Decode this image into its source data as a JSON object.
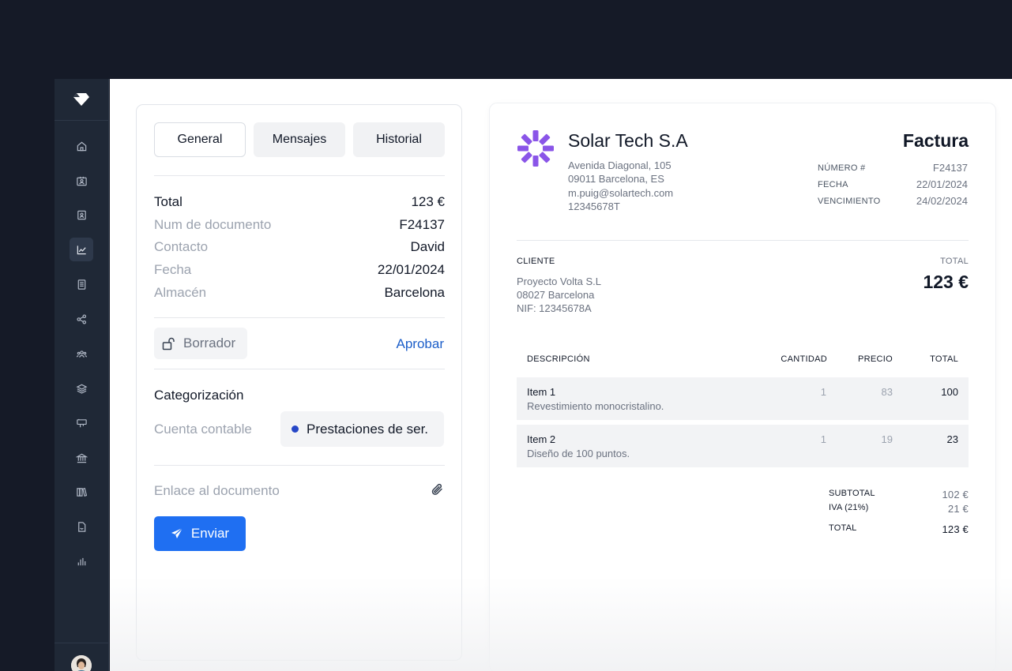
{
  "tabs": [
    {
      "label": "General"
    },
    {
      "label": "Mensajes"
    },
    {
      "label": "Historial"
    }
  ],
  "summary": {
    "total_label": "Total",
    "total_value": "123 €",
    "doc_label": "Num de documento",
    "doc_value": "F24137",
    "contact_label": "Contacto",
    "contact_value": "David",
    "date_label": "Fecha",
    "date_value": "22/01/2024",
    "warehouse_label": "Almacén",
    "warehouse_value": "Barcelona"
  },
  "status": {
    "label": "Borrador",
    "action": "Aprobar"
  },
  "categorization": {
    "title": "Categorización",
    "account_label": "Cuenta contable",
    "account_value": "Prestaciones de ser."
  },
  "document_link": {
    "label": "Enlace al documento"
  },
  "send_button": {
    "label": "Enviar"
  },
  "invoice": {
    "company": "Solar Tech S.A",
    "address": [
      "Avenida Diagonal, 105",
      "09011 Barcelona, ES",
      "m.puig@solartech.com",
      "12345678T"
    ],
    "title": "Factura",
    "meta": [
      {
        "label": "NÚMERO #",
        "value": "F24137"
      },
      {
        "label": "FECHA",
        "value": "22/01/2024"
      },
      {
        "label": "VENCIMIENTO",
        "value": "24/02/2024"
      }
    ],
    "client_label": "CLIENTE",
    "client_lines": [
      "Proyecto Volta S.L",
      "08027 Barcelona",
      "NIF: 12345678A"
    ],
    "total_label": "TOTAL",
    "total_value": "123 €",
    "table_headers": {
      "description": "DESCRIPCIÓN",
      "quantity": "CANTIDAD",
      "price": "PRECIO",
      "total": "TOTAL"
    },
    "items": [
      {
        "name": "Item 1",
        "desc": "Revestimiento monocristalino.",
        "qty": "1",
        "price": "83",
        "total": "100"
      },
      {
        "name": "Item 2",
        "desc": "Diseño de 100 puntos.",
        "qty": "1",
        "price": "19",
        "total": "23"
      }
    ],
    "subtotal_label": "SUBTOTAL",
    "subtotal_value": "102 €",
    "tax_label": "IVA (21%)",
    "tax_value": "21 €",
    "grand_total_label": "TOTAL",
    "grand_total_value": "123 €"
  },
  "colors": {
    "accent": "#1f6ff2",
    "link": "#1d5fc9",
    "logo": "#8a55e8",
    "sidebar": "#1f2836",
    "backdrop": "#151a27"
  },
  "sidebar_icons": [
    "home-icon",
    "contacts-card-icon",
    "id-card-icon",
    "chart-line-icon",
    "document-icon",
    "share-nodes-icon",
    "users-icon",
    "layers-icon",
    "presentation-icon",
    "bank-icon",
    "books-icon",
    "file-pdf-icon",
    "bar-chart-icon"
  ]
}
